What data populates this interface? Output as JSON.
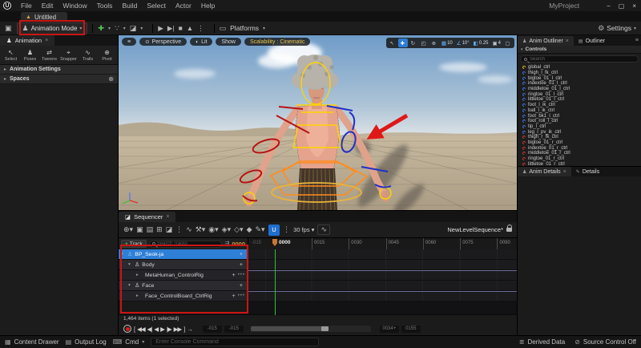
{
  "titlebar": {
    "logo": "U",
    "menus": [
      {
        "label": "File"
      },
      {
        "label": "Edit"
      },
      {
        "label": "Window"
      },
      {
        "label": "Tools"
      },
      {
        "label": "Build"
      },
      {
        "label": "Select"
      },
      {
        "label": "Actor"
      },
      {
        "label": "Help"
      }
    ],
    "project": "MyProject",
    "minimize": "−",
    "maximize": "▢",
    "close": "×"
  },
  "tabstrip": {
    "warning_icon": "▲",
    "tab": "Untitled"
  },
  "toolbar": {
    "save_icon": "▣",
    "animation_mode": "Animation Mode",
    "add_actor_icon": "✚",
    "blueprint_icon": "∵",
    "cinematics_icon": "◪",
    "play": "▶",
    "play_from": "▶|",
    "stop": "■",
    "launch": "▲",
    "more": "⋮",
    "platforms_icon": "▭",
    "platforms": "Platforms",
    "settings_icon": "⚙",
    "settings": "Settings"
  },
  "left_panel": {
    "title": "Animation",
    "tools": [
      {
        "label": "Select",
        "glyph": "↖"
      },
      {
        "label": "Poses",
        "glyph": "♟"
      },
      {
        "label": "Tweens",
        "glyph": "⇄"
      },
      {
        "label": "Snapper",
        "glyph": "⌖"
      },
      {
        "label": "Trails",
        "glyph": "∿"
      },
      {
        "label": "Pivot",
        "glyph": "⊕"
      }
    ],
    "section_settings": "Animation Settings",
    "section_spaces": "Spaces",
    "spaces_icon": "⊕"
  },
  "viewport": {
    "menu_icon": "≡",
    "perspective": "Perspective",
    "lit": "Lit",
    "show": "Show",
    "scalability": "Scalability : Cinematic",
    "tools": [
      {
        "g": "↖",
        "lbl": "",
        "cls": ""
      },
      {
        "g": "✚",
        "lbl": "",
        "cls": "act"
      },
      {
        "g": "↻",
        "lbl": "",
        "cls": ""
      },
      {
        "g": "◰",
        "lbl": "",
        "cls": ""
      },
      {
        "g": "⊕",
        "lbl": "",
        "cls": ""
      },
      {
        "g": "▦",
        "lbl": "10",
        "cls": "act2"
      },
      {
        "g": "∠",
        "lbl": "10°",
        "cls": "act2"
      },
      {
        "g": "◧",
        "lbl": "0.25",
        "cls": "act2"
      },
      {
        "g": "▣",
        "lbl": "4",
        "cls": ""
      },
      {
        "g": "▢",
        "lbl": "",
        "cls": ""
      }
    ]
  },
  "outliner": {
    "tab_active": "Anim Outliner",
    "tab_inactive": "Outliner",
    "burger_icon": "≡",
    "section": "Controls",
    "search_placeholder": "Search",
    "items": [
      {
        "label": "global_ctrl",
        "color": "gold"
      },
      {
        "label": "thigh_l_fk_ctrl",
        "color": "blue"
      },
      {
        "label": "bigtoe_01_l_ctrl",
        "color": "blue"
      },
      {
        "label": "indextoe_01_l_ctrl",
        "color": "blue"
      },
      {
        "label": "middletoe_01_l_ctrl",
        "color": "blue"
      },
      {
        "label": "ringtoe_01_l_ctrl",
        "color": "blue"
      },
      {
        "label": "littletoe_01_l_ctrl",
        "color": "blue"
      },
      {
        "label": "foot_l_ik_ctrl",
        "color": "blue"
      },
      {
        "label": "ball_l_ik_ctrl",
        "color": "blue"
      },
      {
        "label": "foot_bk1_l_ctrl",
        "color": "blue"
      },
      {
        "label": "foot_roll_l_ctrl",
        "color": "blue"
      },
      {
        "label": "tip_l_ctrl",
        "color": "blue"
      },
      {
        "label": "leg_l_pv_ik_ctrl",
        "color": "blue"
      },
      {
        "label": "thigh_r_fk_ctrl",
        "color": "red"
      },
      {
        "label": "bigtoe_01_r_ctrl",
        "color": "red"
      },
      {
        "label": "indextoe_01_r_ctrl",
        "color": "red"
      },
      {
        "label": "middletoe_01_r_ctrl",
        "color": "red"
      },
      {
        "label": "ringtoe_01_r_ctrl",
        "color": "red"
      },
      {
        "label": "littletoe_01_r_ctrl",
        "color": "red"
      }
    ],
    "tab_anim_details": "Anim Details",
    "details_icon": "✎",
    "tab_details": "Details"
  },
  "sequencer": {
    "tab": "Sequencer",
    "tab_icon": "◪",
    "tools": [
      {
        "g": "⊕▾",
        "cls": ""
      },
      {
        "g": "▣",
        "cls": ""
      },
      {
        "g": "▤",
        "cls": ""
      },
      {
        "g": "⊞",
        "cls": ""
      },
      {
        "g": "◪",
        "cls": ""
      },
      {
        "g": "⋮",
        "cls": ""
      },
      {
        "g": "∿",
        "cls": ""
      },
      {
        "g": "⚒▾",
        "cls": ""
      },
      {
        "g": "◉▾",
        "cls": ""
      },
      {
        "g": "◈▾",
        "cls": ""
      },
      {
        "g": "◇▾",
        "cls": ""
      },
      {
        "g": "◆",
        "cls": ""
      },
      {
        "g": "✎▾",
        "cls": ""
      },
      {
        "g": "∪",
        "cls": "act"
      },
      {
        "g": "⋮",
        "cls": ""
      },
      {
        "g": "30 fps ▾",
        "cls": "lbl"
      },
      {
        "g": "∿",
        "cls": "boxed"
      }
    ],
    "sequence_name": "NewLevelSequence*",
    "add_track": "Track",
    "search_placeholder": "Search Tracks",
    "filter_icon": "⇶",
    "current_frame": "0000",
    "ruler_pre": "-015",
    "playhead_label": "0000",
    "ruler": [
      {
        "label": "0015"
      },
      {
        "label": "0030"
      },
      {
        "label": "0045"
      },
      {
        "label": "0060"
      },
      {
        "label": "0075"
      },
      {
        "label": "0090"
      }
    ],
    "tracks": [
      {
        "label": "BP_Seok-ja",
        "cls": "lvl0 sel",
        "exp": "▾",
        "glyph": "♙",
        "glyphcls": "blueico",
        "plus": "+",
        "dots": "",
        "barcls": "bar-blue"
      },
      {
        "label": "Body",
        "cls": "lvl1",
        "exp": "▾",
        "glyph": "♙",
        "glyphcls": "whiteico",
        "plus": "+",
        "dots": "",
        "barcls": "bar-dim"
      },
      {
        "label": "MetaHuman_ControlRig",
        "cls": "lvl2",
        "exp": "▸",
        "glyph": "",
        "glyphcls": "",
        "plus": "+",
        "dots": "•••",
        "barcls": "bar-purple"
      },
      {
        "label": "Face",
        "cls": "lvl1",
        "exp": "▾",
        "glyph": "♙",
        "glyphcls": "whiteico",
        "plus": "+",
        "dots": "",
        "barcls": "bar-dim"
      },
      {
        "label": "Face_ControlBoard_CtrlRig",
        "cls": "lvl2",
        "exp": "▸",
        "glyph": "",
        "glyphcls": "",
        "plus": "+",
        "dots": "•••",
        "barcls": "bar-purple"
      }
    ],
    "items_status": "1,464 items (1 selected)",
    "transport": [
      {
        "g": "["
      },
      {
        "g": "◀◀"
      },
      {
        "g": "◀|"
      },
      {
        "g": "◀"
      },
      {
        "g": "▶"
      },
      {
        "g": "|▶"
      },
      {
        "g": "▶▶"
      },
      {
        "g": "]"
      },
      {
        "g": "→"
      }
    ],
    "range_a": "-015",
    "range_b": "-015",
    "range_c": "0034+",
    "range_d": "0155"
  },
  "statusbar": {
    "content_drawer_icon": "▦",
    "content_drawer": "Content Drawer",
    "output_log_icon": "▤",
    "output_log": "Output Log",
    "cmd_icon": "⌨",
    "cmd": "Cmd",
    "console_placeholder": "Enter Console Command",
    "derived_data_icon": "≣",
    "derived_data": "Derived Data",
    "source_control_icon": "⊘",
    "source_control": "Source Control Off"
  },
  "colors": {
    "selection_blue": "#2d8be4",
    "track_purple": "#56567c",
    "annotation_red": "#cc1414",
    "playhead_green": "#35c035",
    "frame_orange": "#d49a3a",
    "magnet_active_blue": "#1f6fd0",
    "scalability_yellow": "#e8c44a"
  }
}
